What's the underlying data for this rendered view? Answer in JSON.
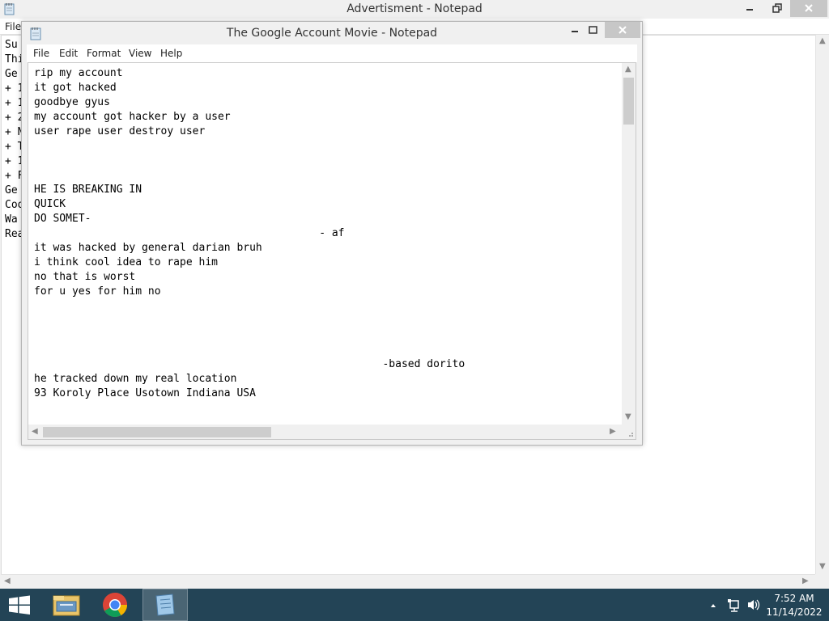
{
  "background_window": {
    "title": "Advertisment - Notepad",
    "menu_file": "File",
    "lines": [
      "Su",
      "Thi",
      "Ge",
      "+ 1",
      "+ 1",
      "+ 2",
      "+ N",
      "+ T",
      "+ 1",
      "+ F",
      "Ge",
      "Coo",
      "Wa",
      "Rea"
    ]
  },
  "foreground_window": {
    "title": "The Google Account Movie - Notepad",
    "menu": [
      "File",
      "Edit",
      "Format",
      "View",
      "Help"
    ],
    "text": "rip my account\nit got hacked\ngoodbye gyus\nmy account got hacker by a user\nuser rape user destroy user\n\n\n\nHE IS BREAKING IN\nQUICK\nDO SOMET-\n                                             - af\nit was hacked by general darian bruh\ni think cool idea to rape him\nno that is worst\nfor u yes for him no\n\n\n\n\n                                                       -based dorito\nhe tracked down my real location\n93 Koroly Place Usotown Indiana USA"
  },
  "taskbar": {
    "apps": [
      "Start",
      "File Explorer",
      "Google Chrome",
      "Notepad"
    ],
    "clock_time": "7:52 AM",
    "clock_date": "11/14/2022"
  },
  "colors": {
    "taskbar": "#234456",
    "window_frame": "#f0f0f0",
    "close_button": "#c7c7c7"
  }
}
